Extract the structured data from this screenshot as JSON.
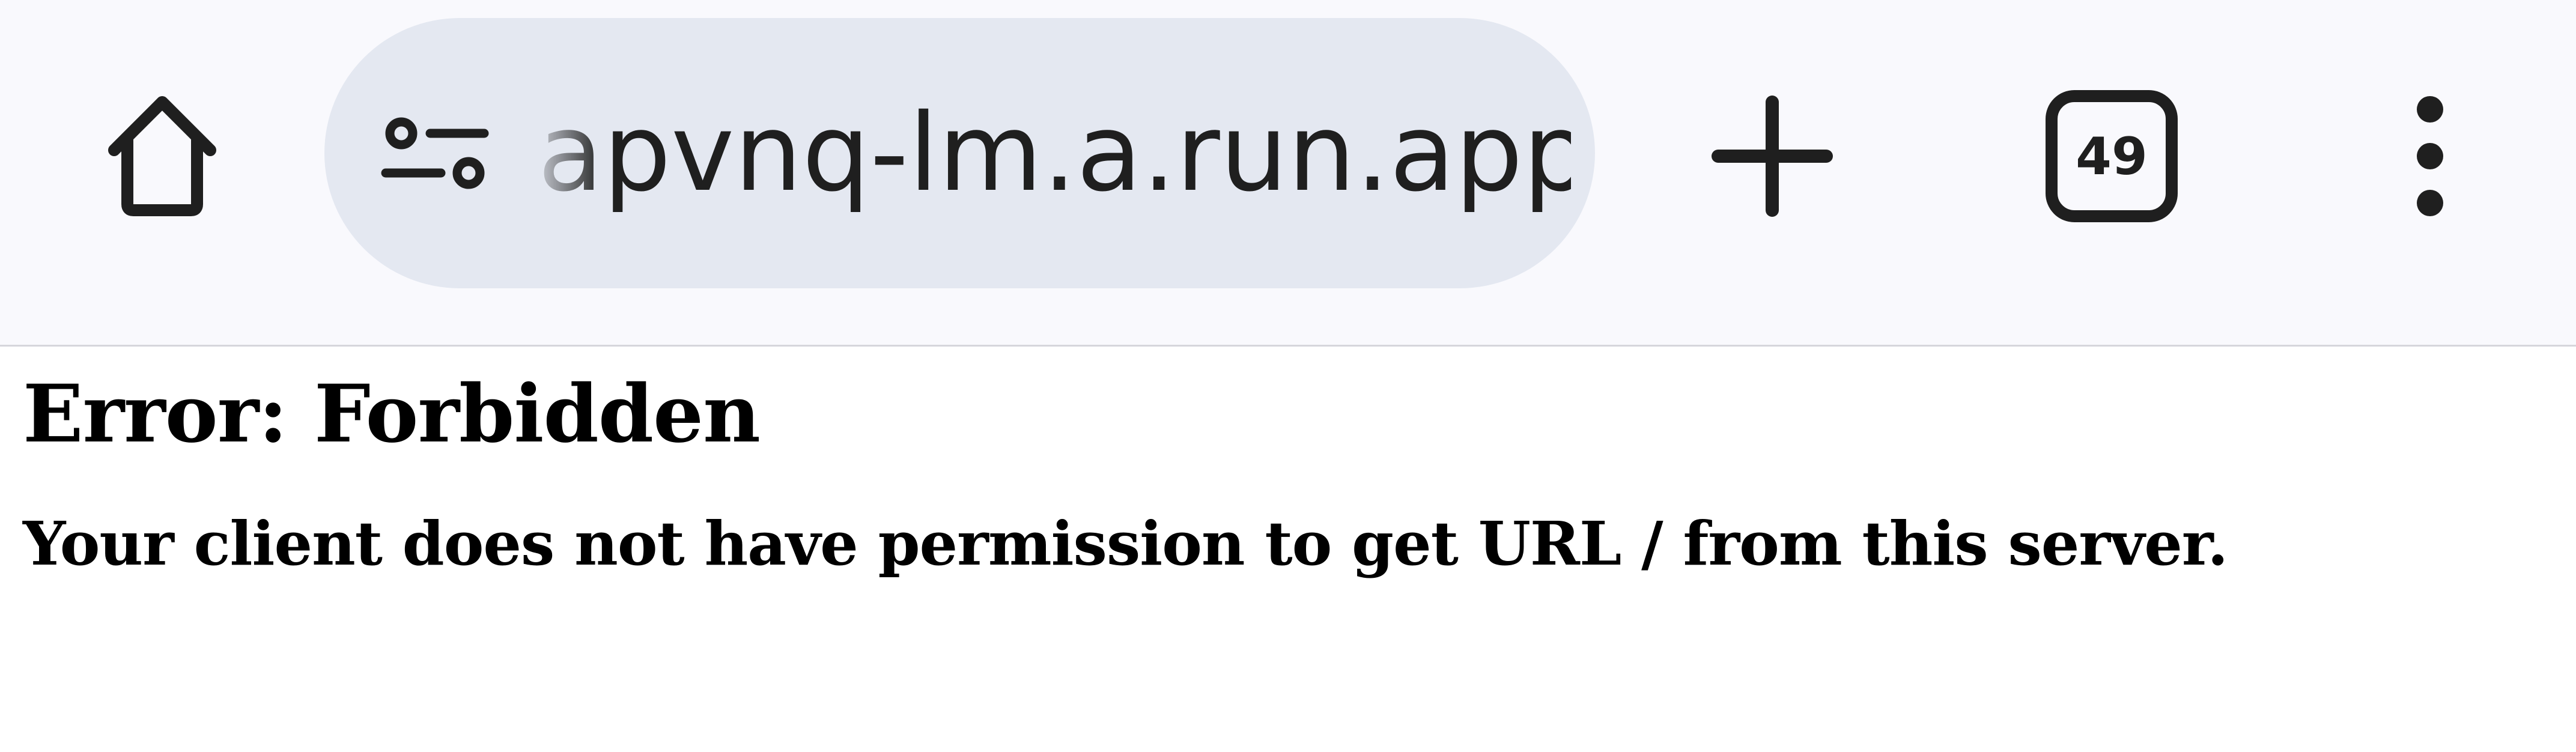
{
  "browser": {
    "toolbar": {
      "home_icon": "home-icon",
      "site_settings_icon": "tune-icon",
      "url": "apvnq-lm.a.run.app",
      "new_tab_icon": "plus-icon",
      "tab_count": "49",
      "menu_icon": "more-vert-icon"
    },
    "colors": {
      "toolbar_background": "#f9f9fd",
      "url_pill_background": "#e4e8f1",
      "icon_color": "#1f1f1f"
    }
  },
  "page": {
    "title": "Error: Forbidden",
    "message": "Your client does not have permission to get URL / from this server."
  }
}
